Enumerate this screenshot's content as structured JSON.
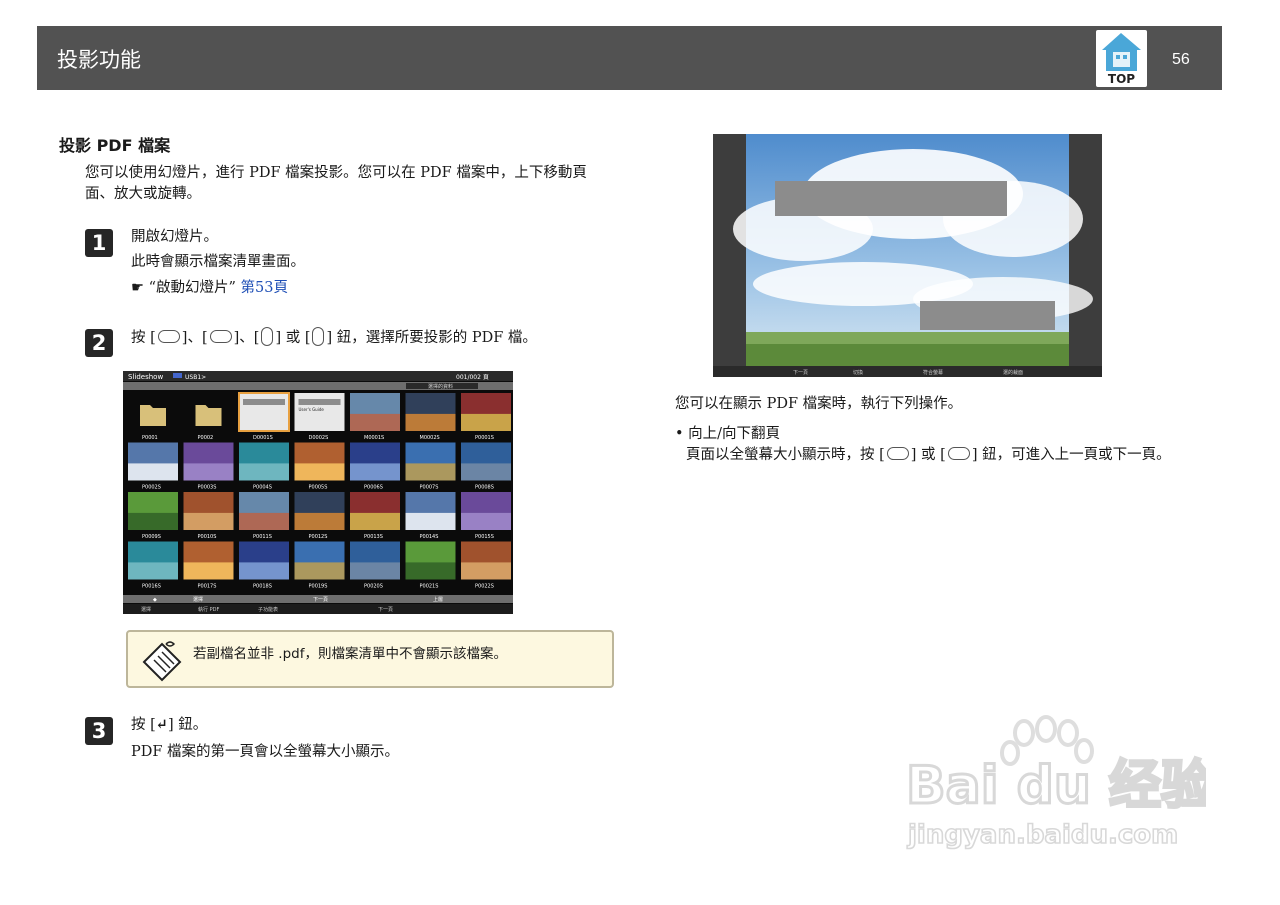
{
  "header": {
    "title": "投影功能",
    "top_label": "TOP",
    "page_number": "56"
  },
  "section": {
    "title": "投影 PDF 檔案",
    "intro": "您可以使用幻燈片，進行 PDF 檔案投影。您可以在 PDF 檔案中，上下移動頁面、放大或旋轉。"
  },
  "steps": [
    {
      "num": "1",
      "line1": "開啟幻燈片。",
      "line2": "此時會顯示檔案清單畫面。",
      "ref_mark": "☛",
      "ref_text": "“啟動幻燈片”",
      "ref_link": "第53頁"
    },
    {
      "num": "2",
      "pre": "按 [",
      "sep1": "]、[",
      "sep2": "]、[",
      "sep3": "] 或 [",
      "post": "] 鈕，選擇所要投影的 PDF 檔。"
    },
    {
      "num": "3",
      "pre": "按 [",
      "enter_glyph": "↵",
      "post": "] 鈕。",
      "line2": "PDF 檔案的第一頁會以全螢幕大小顯示。"
    }
  ],
  "screenshot": {
    "title": "Slideshow",
    "source": "USB1>",
    "page_info": "001/002 頁",
    "top_button": "選擇的資料",
    "bottom_bar": [
      "選擇",
      "檔案",
      "下一頁",
      "上層"
    ],
    "bottom_hints": [
      "選擇",
      "執行 PDF",
      "子功能表",
      "下一頁"
    ],
    "file_labels": [
      "P0001",
      "P0002",
      "D0001S",
      "D0002S",
      "M0001S",
      "M0002S",
      "P0001S",
      "P0002S",
      "P0003S",
      "P0004S",
      "P0005S",
      "P0006S",
      "P0007S",
      "P0008S",
      "P0009S",
      "P0010S",
      "P0011S",
      "P0012S",
      "P0013S",
      "P0014S",
      "P0015S",
      "P0016S",
      "P0017S",
      "P0018S",
      "P0019S",
      "P0020S",
      "P0021S",
      "P0022S"
    ],
    "pdf_tile_text": "User's Guide"
  },
  "note": {
    "text": "若副檔名並非 .pdf，則檔案清單中不會顯示該檔案。"
  },
  "right": {
    "photo_bar": [
      "下一頁",
      "切換",
      "符合螢幕",
      "選的裁面"
    ],
    "caption": "您可以在顯示 PDF 檔案時，執行下列操作。",
    "bullet_title": "• 向上/向下翻頁",
    "bullet_text": "頁面以全螢幕大小顯示時，按 [",
    "bullet_mid": "] 或 [",
    "bullet_end": "] 鈕，可進入上一頁或下一頁。"
  },
  "watermark": {
    "brand": "Bai du 经验",
    "url": "jingyan.baidu.com"
  },
  "colors": {
    "header_bg": "#525252",
    "link": "#1f4fb6",
    "note_bg": "#fdf8e0"
  }
}
